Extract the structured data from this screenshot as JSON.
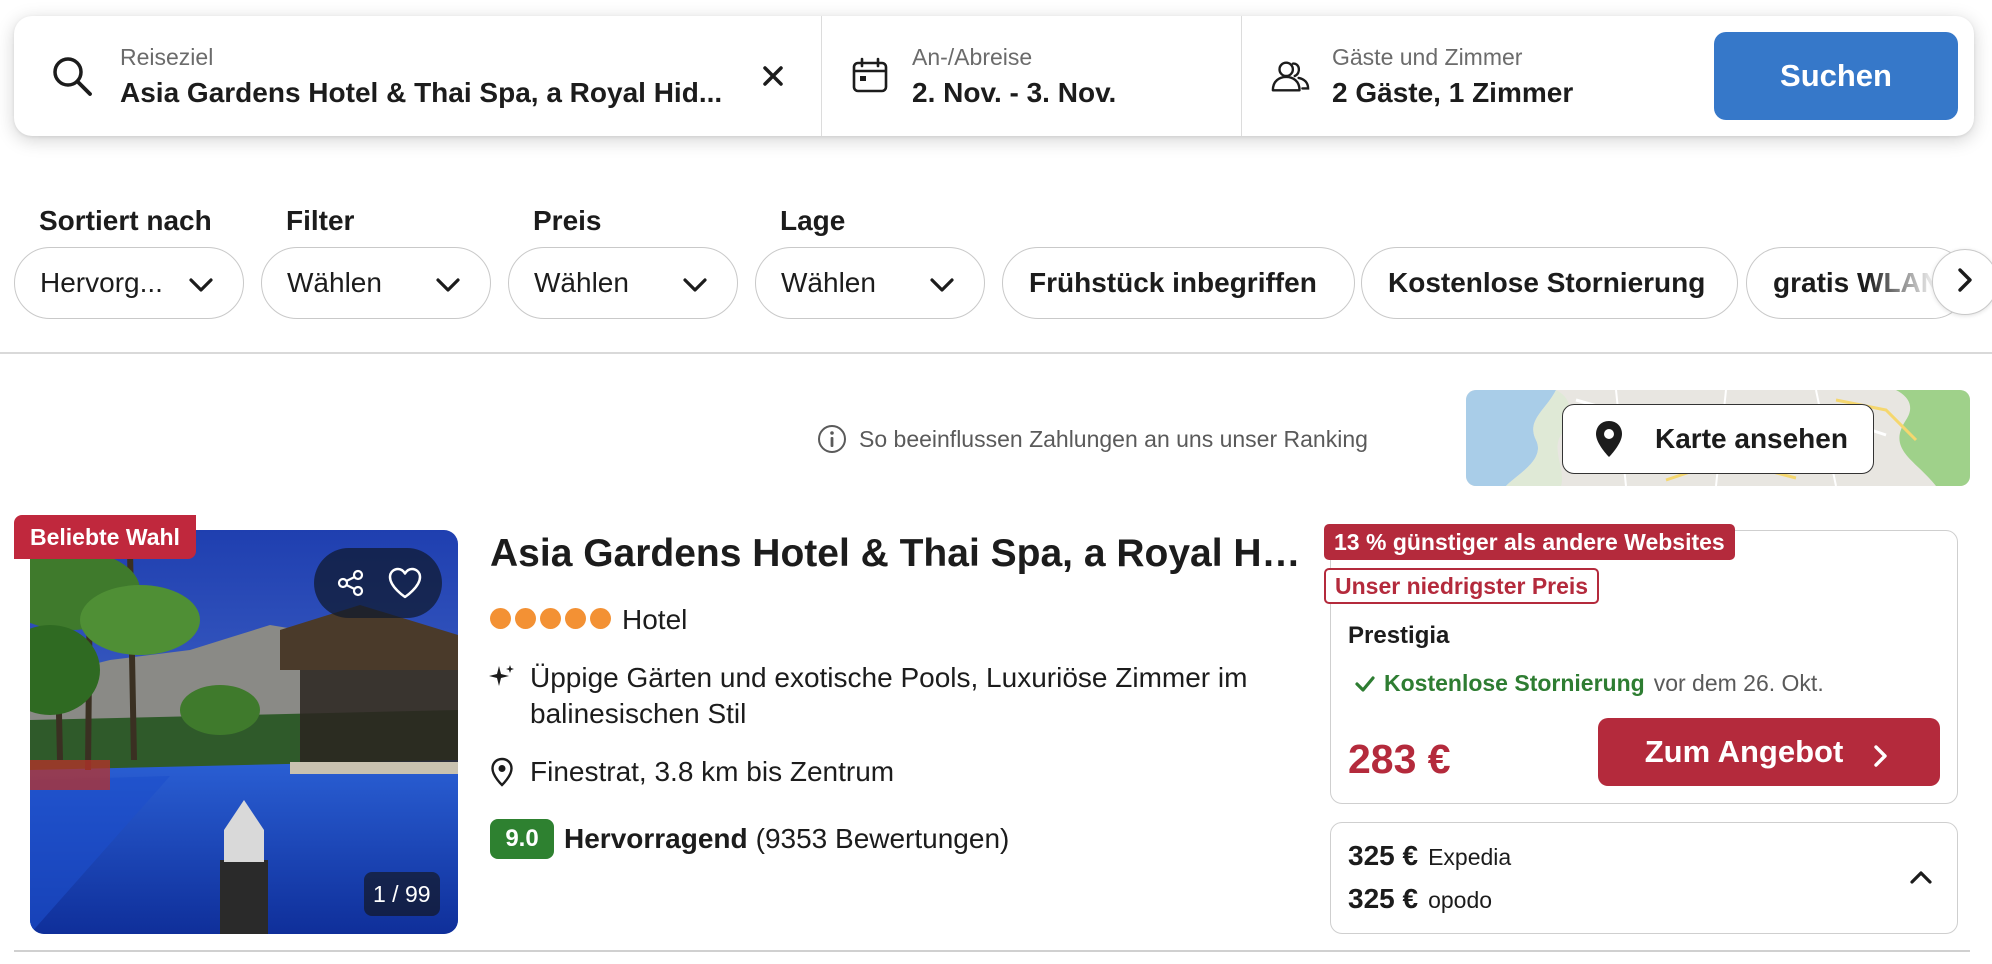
{
  "search": {
    "destination_label": "Reiseziel",
    "destination_value": "Asia Gardens Hotel & Thai Spa, a Royal Hid...",
    "dates_label": "An-/Abreise",
    "dates_value": "2. Nov. - 3. Nov.",
    "guests_label": "Gäste und Zimmer",
    "guests_value": "2 Gäste, 1 Zimmer",
    "search_button": "Suchen"
  },
  "filters": {
    "sort": {
      "label": "Sortiert nach",
      "value": "Hervorg..."
    },
    "filter": {
      "label": "Filter",
      "value": "Wählen"
    },
    "price": {
      "label": "Preis",
      "value": "Wählen"
    },
    "location": {
      "label": "Lage",
      "value": "Wählen"
    },
    "chips": [
      "Frühstück inbegriffen",
      "Kostenlose Stornierung",
      "gratis WLAN"
    ]
  },
  "ranking_note": "So beeinflussen Zahlungen an uns unser Ranking",
  "map_button": "Karte ansehen",
  "hotel": {
    "badge": "Beliebte Wahl",
    "photo_counter": "1 / 99",
    "name": "Asia Gardens Hotel & Thai Spa, a Royal Hi...",
    "stars": 5,
    "type": "Hotel",
    "highlight": "Üppige Gärten und exotische Pools, Luxuriöse Zimmer im balinesischen Stil",
    "location": "Finestrat, 3.8 km bis Zentrum",
    "rating_score": "9.0",
    "rating_word": "Hervorragend",
    "rating_count": "(9353 Bewertungen)"
  },
  "offer": {
    "tag_cheaper": "13 % günstiger als andere Websites",
    "tag_lowest": "Unser niedrigster Preis",
    "provider": "Prestigia",
    "cancel_strong": "Kostenlose Stornierung",
    "cancel_rest": "vor dem 26. Okt.",
    "price": "283 €",
    "deal_button": "Zum Angebot",
    "alternatives": [
      {
        "price": "325 €",
        "provider": "Expedia"
      },
      {
        "price": "325 €",
        "provider": "opodo"
      }
    ]
  },
  "colors": {
    "search_button": "#3678c9",
    "deal": "#b42a3c",
    "rating": "#2e8130",
    "stars": "#f39134"
  }
}
